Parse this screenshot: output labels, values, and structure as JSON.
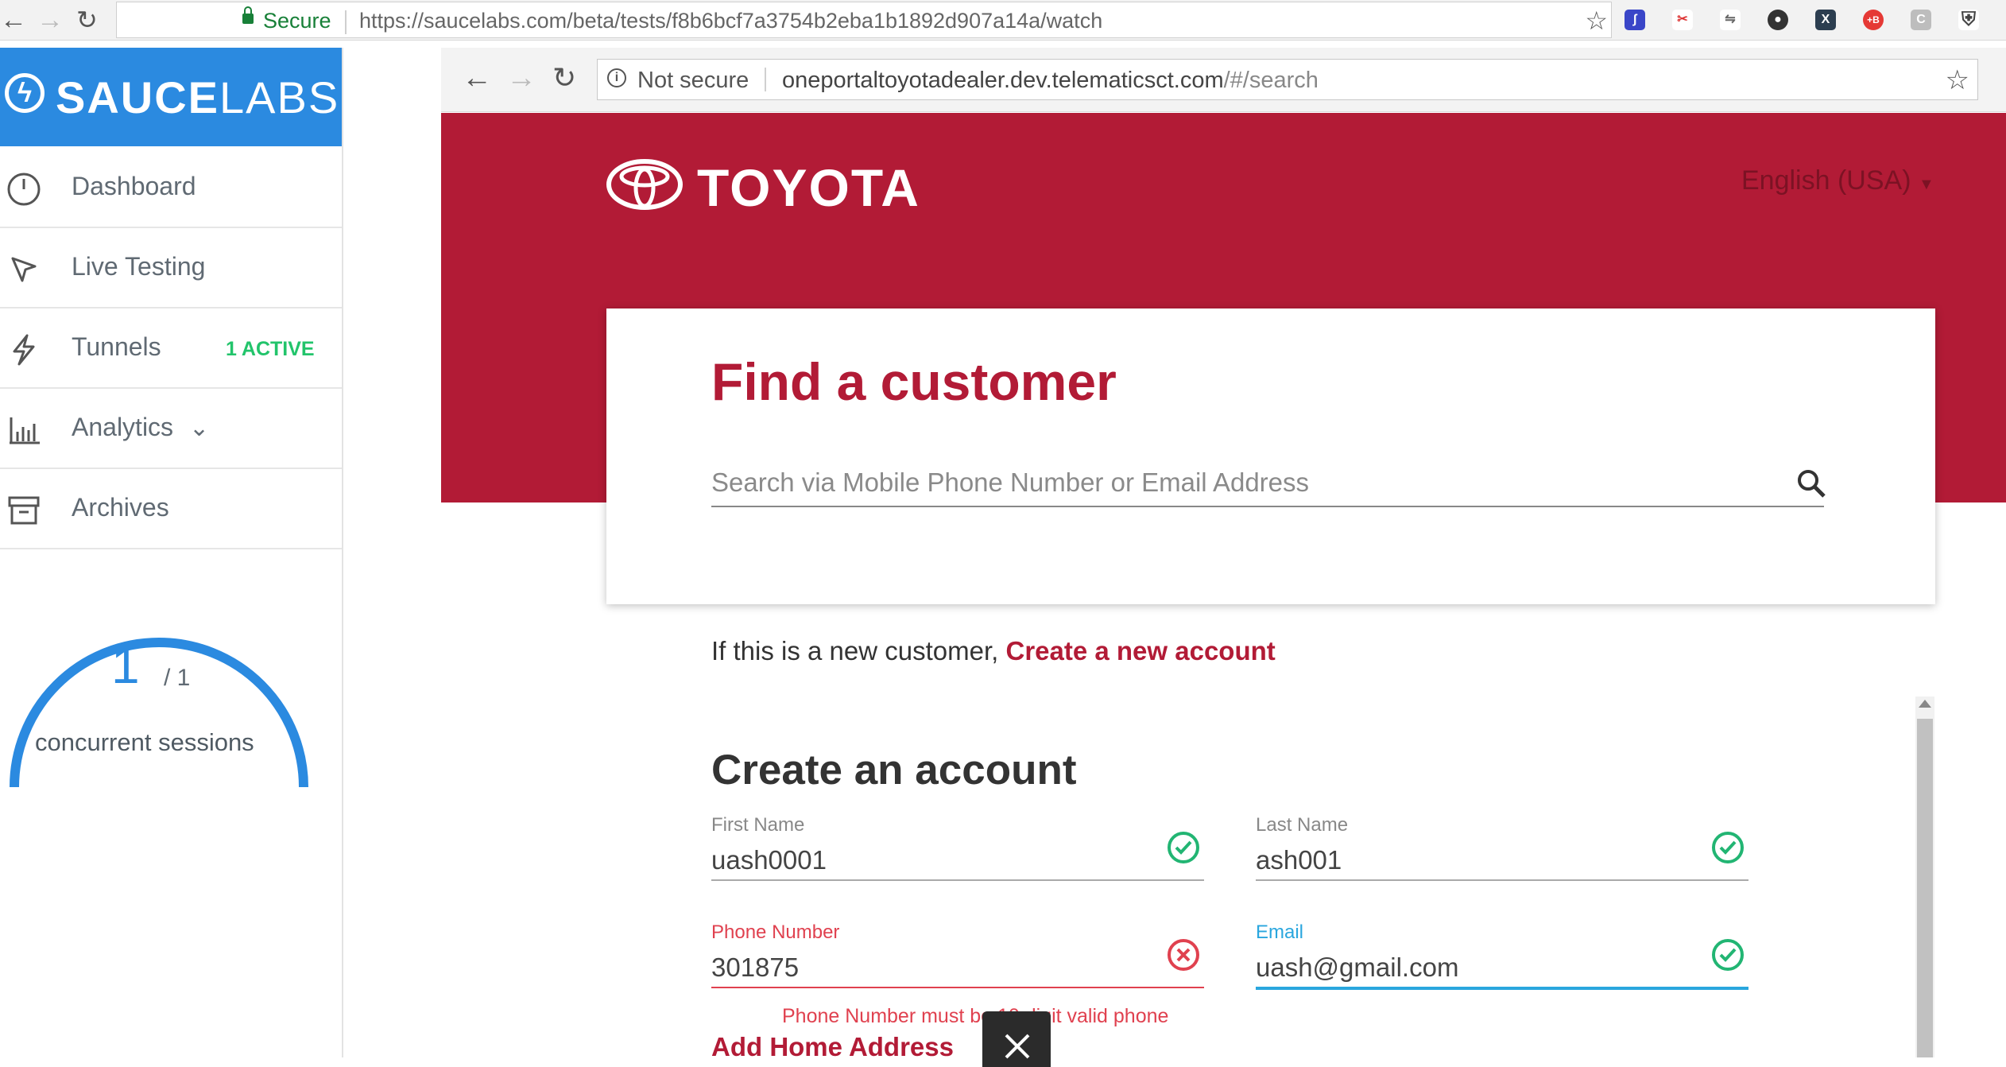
{
  "outer_browser": {
    "secure_label": "Secure",
    "url": "https://saucelabs.com/beta/tests/f8b6bcf7a3754b2eba1b1892d907a14a/watch"
  },
  "sidebar": {
    "brand_sauce": "SAUCE",
    "brand_labs": "LABS",
    "brand_color": "#2b8ae0",
    "items": [
      {
        "label": "Dashboard",
        "icon": "dashboard-gauge-icon"
      },
      {
        "label": "Live Testing",
        "icon": "cursor-icon"
      },
      {
        "label": "Tunnels",
        "icon": "lightning-icon",
        "badge": "1 ACTIVE"
      },
      {
        "label": "Analytics",
        "icon": "bar-chart-icon"
      },
      {
        "label": "Archives",
        "icon": "archive-box-icon"
      }
    ],
    "concurrency": {
      "current": "1",
      "total": "/ 1",
      "label": "concurrent sessions",
      "fraction": 1.0
    }
  },
  "inner_browser": {
    "security": "Not secure",
    "url_host": "oneportaltoyotadealer.dev.telematicsct.com",
    "url_path": "/#/search"
  },
  "toyota": {
    "brand": "TOYOTA",
    "brand_color": "#b21b36",
    "language": "English (USA)",
    "find_title": "Find a customer",
    "search_placeholder": "Search via Mobile Phone Number or Email Address",
    "new_customer_prefix": "If this is a new customer,",
    "create_link": "Create a new account",
    "create_title": "Create an account",
    "fields": {
      "first_name": {
        "label": "First Name",
        "value": "uash0001",
        "status": "valid"
      },
      "last_name": {
        "label": "Last Name",
        "value": "ash001",
        "status": "valid"
      },
      "phone": {
        "label": "Phone Number",
        "value": "301875",
        "status": "invalid"
      },
      "email": {
        "label": "Email",
        "value": "uash@gmail.com",
        "status": "valid"
      }
    },
    "phone_error": "Phone Number must be 10 digit valid phone",
    "add_home_address": "Add Home Address"
  }
}
